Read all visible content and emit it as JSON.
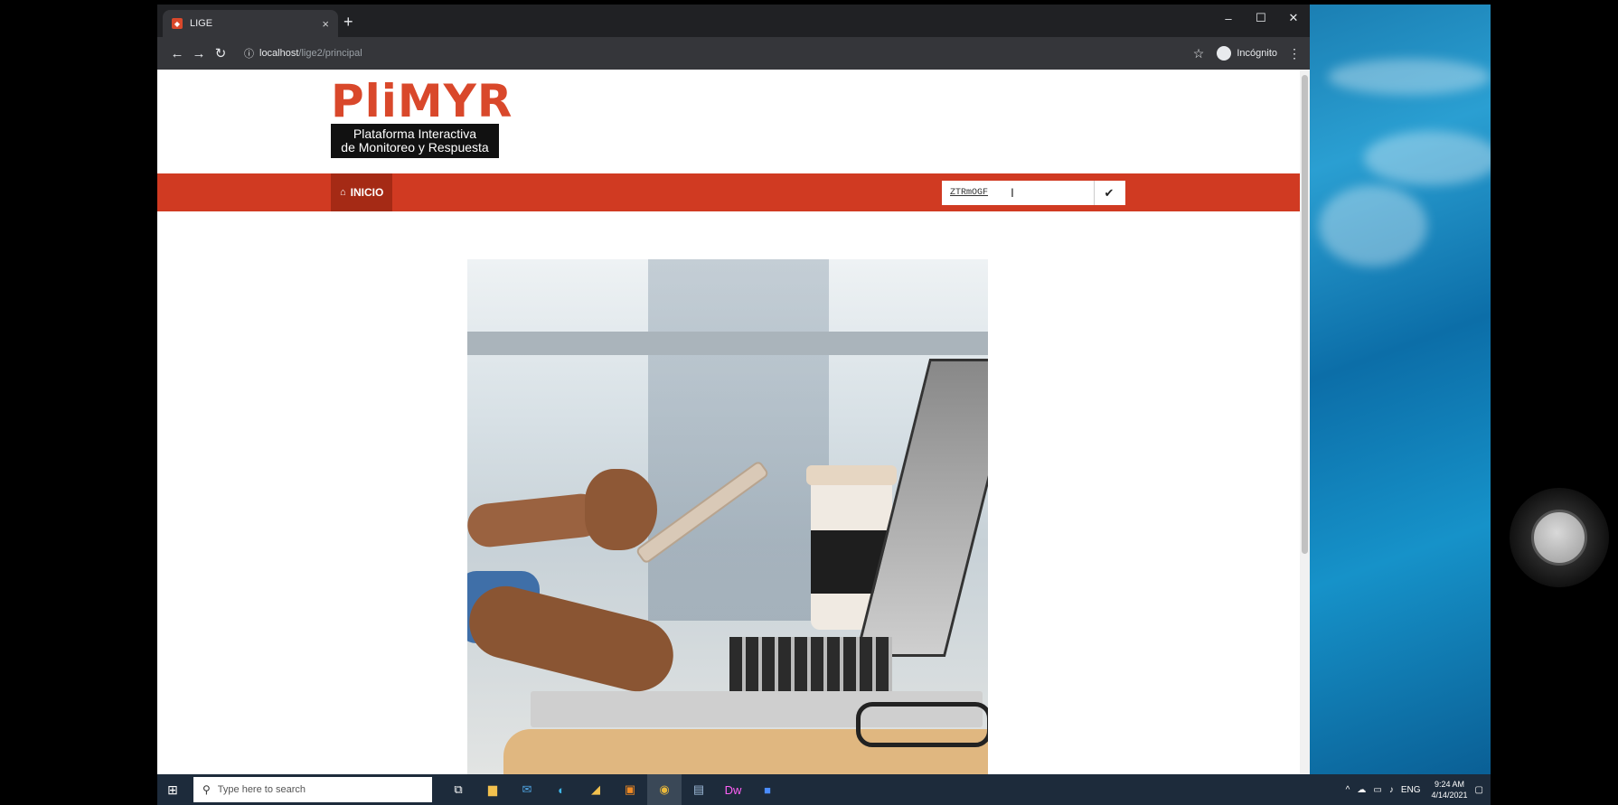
{
  "browser": {
    "tab_title": "LIGE",
    "tab_close": "×",
    "new_tab": "+",
    "url_host": "localhost",
    "url_path": "/lige2/principal",
    "incognito_label": "Incógnito",
    "win_minimize": "–",
    "win_maximize": "☐",
    "win_close": "✕"
  },
  "site": {
    "logo_word": "PliMYR",
    "logo_sub_line1": "Plataforma Interactiva",
    "logo_sub_line2": "de Monitoreo y Respuesta",
    "nav_home_label": "INICIO",
    "code_value": "ZTRmOGF",
    "submit_icon": "check-icon",
    "brand_color": "#d03a22"
  },
  "taskbar": {
    "search_placeholder": "Type here to search",
    "lang": "ENG",
    "time": "9:24 AM",
    "date": "4/14/2021"
  }
}
